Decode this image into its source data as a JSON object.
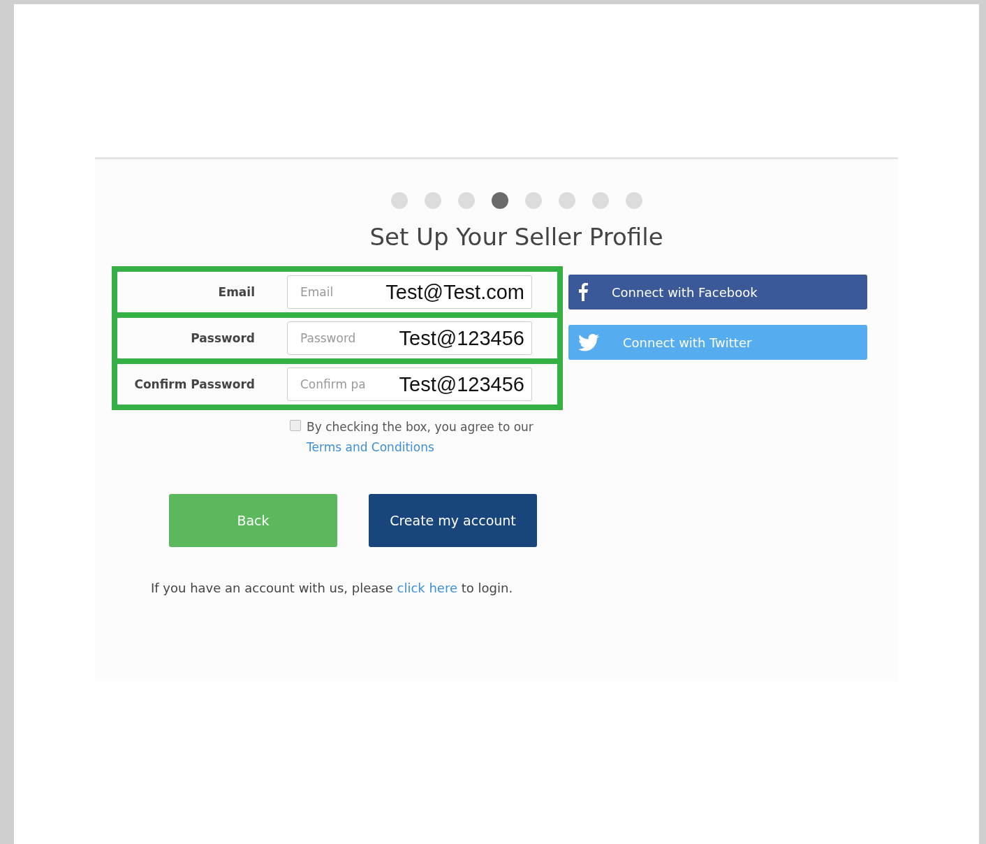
{
  "steps": [
    {
      "selected": false
    },
    {
      "selected": false
    },
    {
      "selected": false
    },
    {
      "selected": true
    },
    {
      "selected": false
    },
    {
      "selected": false
    },
    {
      "selected": false
    },
    {
      "selected": false
    }
  ],
  "title": "Set Up Your Seller Profile",
  "fields": [
    {
      "label": "Email",
      "hint": "Email",
      "value": "Test@Test.com"
    },
    {
      "label": "Password",
      "hint": "Password",
      "value": "Test@123456"
    },
    {
      "label": "Confirm Password",
      "hint": "Confirm pa",
      "value": "Test@123456"
    }
  ],
  "social": [
    {
      "kind": "facebook",
      "label": "Connect with Facebook"
    },
    {
      "kind": "twitter",
      "label": "Connect with Twitter"
    }
  ],
  "terms": {
    "checked": false,
    "text": "By checking the box, you agree to our",
    "link": "Terms and Conditions"
  },
  "buttons": [
    {
      "kind": "secondary",
      "label": "Back"
    },
    {
      "kind": "primary",
      "label": "Create my account"
    }
  ],
  "login": {
    "before": "If you have an account with us, please",
    "link": "click here",
    "after": "to login."
  }
}
